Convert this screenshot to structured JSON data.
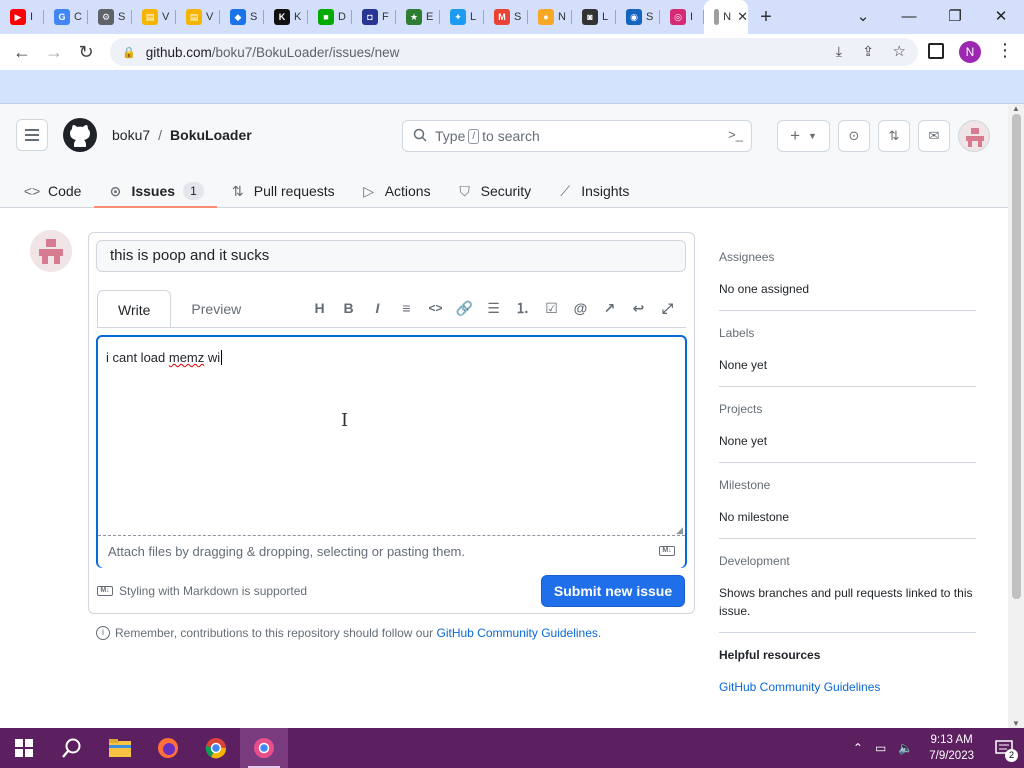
{
  "browser": {
    "tabs": [
      {
        "icon": "youtube-icon",
        "label": "I",
        "color": "#ff0000",
        "glyph": "▶"
      },
      {
        "icon": "google-icon",
        "label": "C",
        "color": "#4285f4",
        "glyph": "G"
      },
      {
        "icon": "settings-icon",
        "label": "S",
        "color": "#5f6368",
        "glyph": "⚙"
      },
      {
        "icon": "folder-icon",
        "label": "V",
        "color": "#f4b400",
        "glyph": "▤"
      },
      {
        "icon": "folder-icon",
        "label": "V",
        "color": "#f4b400",
        "glyph": "▤"
      },
      {
        "icon": "app-icon",
        "label": "S",
        "color": "#1a73e8",
        "glyph": "◆"
      },
      {
        "icon": "kim-icon",
        "label": "K",
        "color": "#111",
        "glyph": "K"
      },
      {
        "icon": "game-icon",
        "label": "D",
        "color": "#0a0",
        "glyph": "■"
      },
      {
        "icon": "pixel-icon",
        "label": "F",
        "color": "#283593",
        "glyph": "◘"
      },
      {
        "icon": "star-icon",
        "label": "E",
        "color": "#2e7d32",
        "glyph": "★"
      },
      {
        "icon": "twitter-icon",
        "label": "L",
        "color": "#1d9bf0",
        "glyph": "✦"
      },
      {
        "icon": "gmail-icon",
        "label": "S",
        "color": "#ea4335",
        "glyph": "M"
      },
      {
        "icon": "bulb-icon",
        "label": "N",
        "color": "#f9a825",
        "glyph": "●"
      },
      {
        "icon": "mask-icon",
        "label": "L",
        "color": "#333",
        "glyph": "◙"
      },
      {
        "icon": "sonic-icon",
        "label": "S",
        "color": "#1565c0",
        "glyph": "◉"
      },
      {
        "icon": "instagram-icon",
        "label": "I",
        "color": "#d62976",
        "glyph": "◎"
      },
      {
        "icon": "page-icon",
        "label": "N",
        "color": "#9e9e9e",
        "glyph": "",
        "active": true
      }
    ],
    "url_host": "github.com",
    "url_path": "/boku7/BokuLoader/issues/new",
    "profile_initial": "N"
  },
  "header": {
    "owner": "boku7",
    "separator": "/",
    "repo": "BokuLoader",
    "search_pre": "Type",
    "search_key": "/",
    "search_post": "to search"
  },
  "repo_nav": [
    {
      "name": "code",
      "icon": "code-icon",
      "label": "Code",
      "glyph": "<>"
    },
    {
      "name": "issues",
      "icon": "issue-icon",
      "label": "Issues",
      "count": "1",
      "selected": true,
      "glyph": "⊙"
    },
    {
      "name": "pull-requests",
      "icon": "pull-request-icon",
      "label": "Pull requests",
      "glyph": "⇅"
    },
    {
      "name": "actions",
      "icon": "play-icon",
      "label": "Actions",
      "glyph": "▷"
    },
    {
      "name": "security",
      "icon": "shield-icon",
      "label": "Security",
      "glyph": "⛉"
    },
    {
      "name": "insights",
      "icon": "graph-icon",
      "label": "Insights",
      "glyph": "⟋"
    }
  ],
  "issue": {
    "title_value": "this is poop and it sucks",
    "tab_write": "Write",
    "tab_preview": "Preview",
    "body_prefix": "i cant load ",
    "body_misspelled": "memz",
    "body_suffix": " wi",
    "attach_text": "Attach files by dragging & dropping, selecting or pasting them.",
    "markdown_note": "Styling with Markdown is supported",
    "submit_label": "Submit new issue",
    "remember_text": "Remember, contributions to this repository should follow our",
    "guidelines_link": "GitHub Community Guidelines",
    "remember_end": "."
  },
  "toolbar": [
    {
      "name": "heading-icon",
      "glyph": "H"
    },
    {
      "name": "bold-icon",
      "glyph": "B"
    },
    {
      "name": "italic-icon",
      "glyph": "I"
    },
    {
      "name": "quote-icon",
      "glyph": "≡"
    },
    {
      "name": "code-icon",
      "glyph": "<>"
    },
    {
      "name": "link-icon",
      "glyph": "🔗"
    },
    {
      "name": "unordered-list-icon",
      "glyph": "☰"
    },
    {
      "name": "ordered-list-icon",
      "glyph": "⒈"
    },
    {
      "name": "task-list-icon",
      "glyph": "☑"
    },
    {
      "name": "mention-icon",
      "glyph": "@"
    },
    {
      "name": "cross-reference-icon",
      "glyph": "↗"
    },
    {
      "name": "reply-icon",
      "glyph": "↩"
    },
    {
      "name": "fullscreen-icon",
      "glyph": "⤢"
    }
  ],
  "sidebar": [
    {
      "heading": "Assignees",
      "value": "No one assigned"
    },
    {
      "heading": "Labels",
      "value": "None yet"
    },
    {
      "heading": "Projects",
      "value": "None yet"
    },
    {
      "heading": "Milestone",
      "value": "No milestone"
    },
    {
      "heading": "Development",
      "value": "Shows branches and pull requests linked to this issue."
    },
    {
      "heading": "Helpful resources",
      "value": "GitHub Community Guidelines"
    }
  ],
  "taskbar": {
    "time": "9:13 AM",
    "date": "7/9/2023",
    "notification_count": "2"
  },
  "colors": {
    "accent": "#1f6feb",
    "taskbar": "#5c1f60",
    "tab_underline": "#fd8c73"
  }
}
